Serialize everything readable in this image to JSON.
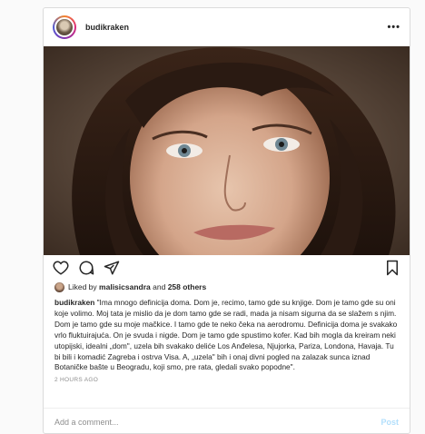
{
  "post": {
    "username": "budikraken",
    "menu_label": "•••",
    "liked_by_prefix": "Liked by",
    "liked_by_user": "malisicsandra",
    "liked_by_and": "and",
    "liked_by_others": "258 others",
    "caption_text": "\"Ima mnogo definicija doma. Dom je, recimo, tamo gde su knjige. Dom je tamo gde su oni koje volimo. Moj tata je mislio da je dom tamo gde se radi, mada ja nisam sigurna da se slažem s njim. Dom je tamo gde su moje mačkice. I tamo gde te neko čeka na aerodromu. Definicija doma je svakako vrlo fluktuirajuća. On je svuda i nigde. Dom je tamo gde spustimo kofer. Kad bih mogla da kreiram neki utopijski, idealni „dom\", uzela bih svakako deliće Los Anđelesa, Njujorka, Pariza, Londona, Havaja. Tu bi bili i komadić Zagreba i ostrva Visa. A, „uzela\" bih i onaj divni pogled na zalazak sunca iznad Botaničke bašte u Beogradu, koji smo, pre rata, gledali svako popodne\".",
    "timestamp": "2 HOURS AGO",
    "comment_placeholder": "Add a comment...",
    "post_label": "Post"
  },
  "icons": {
    "like": "heart-icon",
    "comment": "comment-icon",
    "share": "share-icon",
    "save": "bookmark-icon",
    "more": "more-icon"
  },
  "colors": {
    "post_button_disabled": "#b2dffc",
    "secondary_text": "#8e8e8e",
    "border": "#dbdbdb"
  }
}
